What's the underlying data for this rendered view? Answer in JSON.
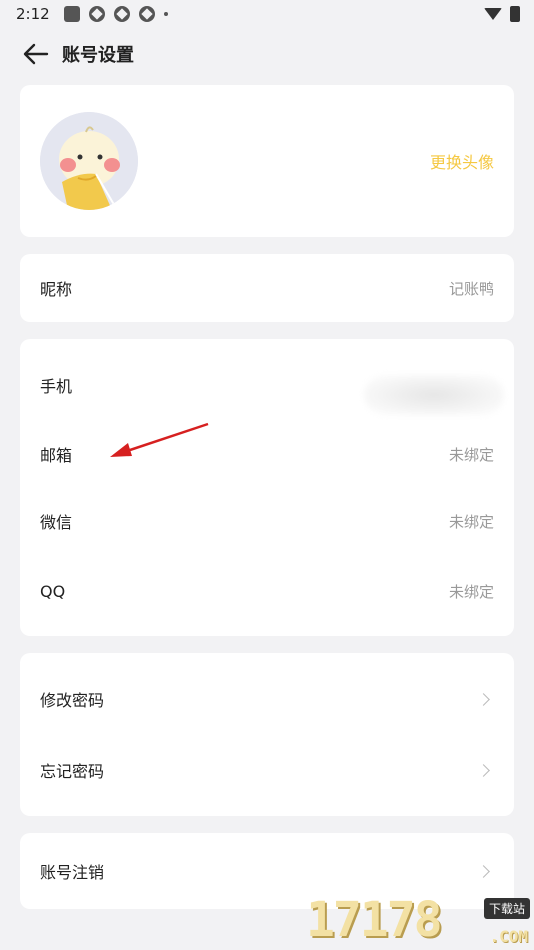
{
  "status_bar": {
    "time": "2:12"
  },
  "header": {
    "title": "账号设置"
  },
  "avatar_card": {
    "change_label": "更换头像"
  },
  "nickname": {
    "label": "昵称",
    "value": "记账鸭"
  },
  "bindings": [
    {
      "label": "手机",
      "value": ""
    },
    {
      "label": "邮箱",
      "value": "未绑定"
    },
    {
      "label": "微信",
      "value": "未绑定"
    },
    {
      "label": "QQ",
      "value": "未绑定"
    }
  ],
  "password": [
    {
      "label": "修改密码"
    },
    {
      "label": "忘记密码"
    }
  ],
  "account": {
    "cancel_label": "账号注销"
  },
  "watermark": {
    "text": "17178",
    "badge": "下载站",
    "suffix": ".COM"
  },
  "colors": {
    "accent": "#f5c842",
    "background": "#f2f2f4",
    "annotation": "#d62020"
  },
  "icons": [
    "back-arrow-icon",
    "chevron-right-icon",
    "wifi-icon",
    "battery-icon"
  ]
}
